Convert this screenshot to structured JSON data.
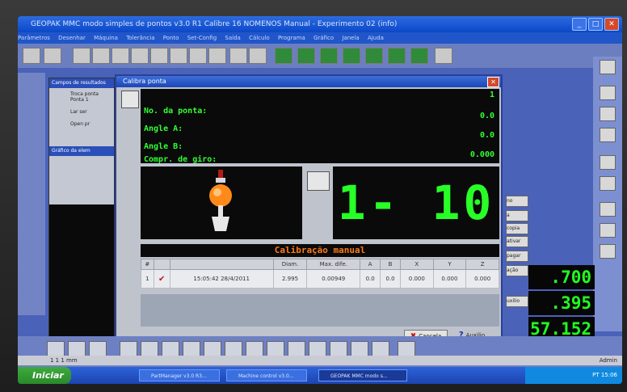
{
  "window": {
    "title": "GEOPAK MMC modo simples de pontos v3.0 R1 Calibre 16 NOMENOS Manual - Experimento 02 (info)"
  },
  "menu": [
    "Parâmetros",
    "Desenhar",
    "Máquina",
    "Tolerância",
    "Ponto",
    "Set-Config",
    "Saída",
    "Cálculo",
    "Programa",
    "Gráfico",
    "Janela",
    "Ajuda"
  ],
  "left_panel": {
    "title": "Campos de resultados",
    "items": [
      "Troca ponta Ponta 1",
      "Lar ser",
      "Open pr"
    ],
    "graphics_title": "Gráfico da elem"
  },
  "dialog": {
    "title": "Calibra ponta",
    "fields": [
      {
        "label": "No. da ponta:",
        "value": "1"
      },
      {
        "label": "Angle A:",
        "value": "0.0"
      },
      {
        "label": "Angle B:",
        "value": "0.0"
      },
      {
        "label": "Compr. de giro:",
        "value": "0.000"
      }
    ],
    "counter": "1- 10",
    "calibration_title": "Calibração manual",
    "table": {
      "headers": [
        "#",
        "",
        "Diam.",
        "Max. dife.",
        "A",
        "B",
        "X",
        "Y",
        "Z"
      ],
      "rows": [
        [
          "1",
          "",
          "15:05:42 28/4/2011",
          "2.995",
          "0.00949",
          "0.0",
          "0.0",
          "0.000",
          "0.000",
          "0.000"
        ]
      ]
    },
    "cancel_label": "Cancela",
    "help_label": "Auxilio"
  },
  "side_buttons": [
    "no",
    "a",
    "copia",
    "ativar",
    "pagar",
    "ação",
    "uxilio"
  ],
  "readouts": [
    ".700",
    ".395",
    "57.152"
  ],
  "status": {
    "left": "1 1 1 mm",
    "user": "Admin"
  },
  "taskbar": {
    "start": "Iniciar",
    "tasks": [
      "PartManager v3.0 R3...",
      "Machine control v3.0...",
      "GEOPAK MMC modo s..."
    ],
    "clock": "PT  15:06"
  }
}
